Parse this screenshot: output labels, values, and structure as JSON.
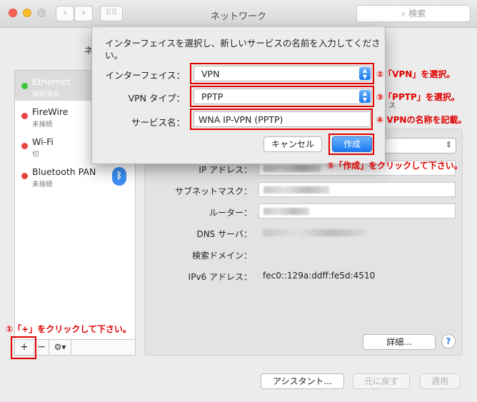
{
  "window": {
    "title": "ネットワーク",
    "search_placeholder": "検索",
    "location_label_partial": "ネ"
  },
  "sidebar": {
    "items": [
      {
        "name": "Ethernet",
        "status": "接続済み",
        "status_color": "#3cc43c",
        "selected": true
      },
      {
        "name": "FireWire",
        "status": "未接続",
        "status_color": "#e84545",
        "selected": false
      },
      {
        "name": "Wi-Fi",
        "status": "切",
        "status_color": "#e84545",
        "selected": false
      },
      {
        "name": "Bluetooth PAN",
        "status": "未接続",
        "status_color": "#e84545",
        "selected": false
      }
    ],
    "add_label": "+",
    "remove_label": "−",
    "gear_label": "⚙▾"
  },
  "detail": {
    "partial_status_text": "ス",
    "rows": [
      {
        "label": "IP アドレス：",
        "value": ""
      },
      {
        "label": "サブネットマスク：",
        "value": ""
      },
      {
        "label": "ルーター：",
        "value": ""
      },
      {
        "label": "DNS サーバ：",
        "value": ""
      },
      {
        "label": "検索ドメイン：",
        "value": ""
      },
      {
        "label": "IPv6 アドレス：",
        "value": "fec0::129a:ddff:fe5d:4510"
      }
    ],
    "advanced_label": "詳細...",
    "help_label": "?"
  },
  "footer": {
    "assistant_label": "アシスタント...",
    "revert_label": "元に戻す",
    "apply_label": "適用"
  },
  "sheet": {
    "prompt": "インターフェイスを選択し、新しいサービスの名前を入力してください。",
    "interface_label": "インターフェイス：",
    "interface_value": "VPN",
    "vpn_type_label": "VPN タイプ：",
    "vpn_type_value": "PPTP",
    "service_name_label": "サービス名：",
    "service_name_value": "WNA IP-VPN (PPTP)",
    "cancel_label": "キャンセル",
    "create_label": "作成"
  },
  "annotations": {
    "step1": "①「+」をクリックして下さい。",
    "step2": "②「VPN」を選択。",
    "step3": "③「PPTP」を選択。",
    "step4": "④ VPNの名称を記載。",
    "step5": "⑤「作成」をクリックして下さい。",
    "color": "#e10000"
  }
}
